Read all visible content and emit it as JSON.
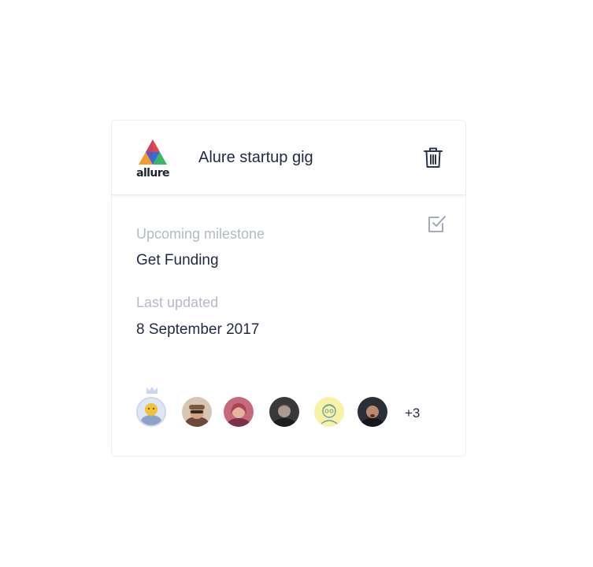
{
  "project": {
    "title": "Alure startup gig",
    "logo_text": "allure",
    "logo_icon": "allure-triangle-logo"
  },
  "actions": {
    "delete_icon": "trash-icon",
    "complete_icon": "checkbox-checked-icon"
  },
  "milestone": {
    "label": "Upcoming milestone",
    "value": "Get Funding"
  },
  "updated": {
    "label": "Last updated",
    "value": "8 September 2017"
  },
  "members": {
    "owner_badge_icon": "crown-icon",
    "avatars": [
      "owner-avatar",
      "member-avatar",
      "member-avatar",
      "member-avatar",
      "member-avatar",
      "member-avatar"
    ],
    "more_count": "+3"
  },
  "colors": {
    "text_primary": "#1f2a44",
    "text_muted": "#b4bac7",
    "logo_red": "#e8453c",
    "logo_orange": "#f39c2b",
    "logo_blue": "#2f6fd8",
    "logo_green": "#3bb56a",
    "owner_ring": "#c9d6f5"
  }
}
